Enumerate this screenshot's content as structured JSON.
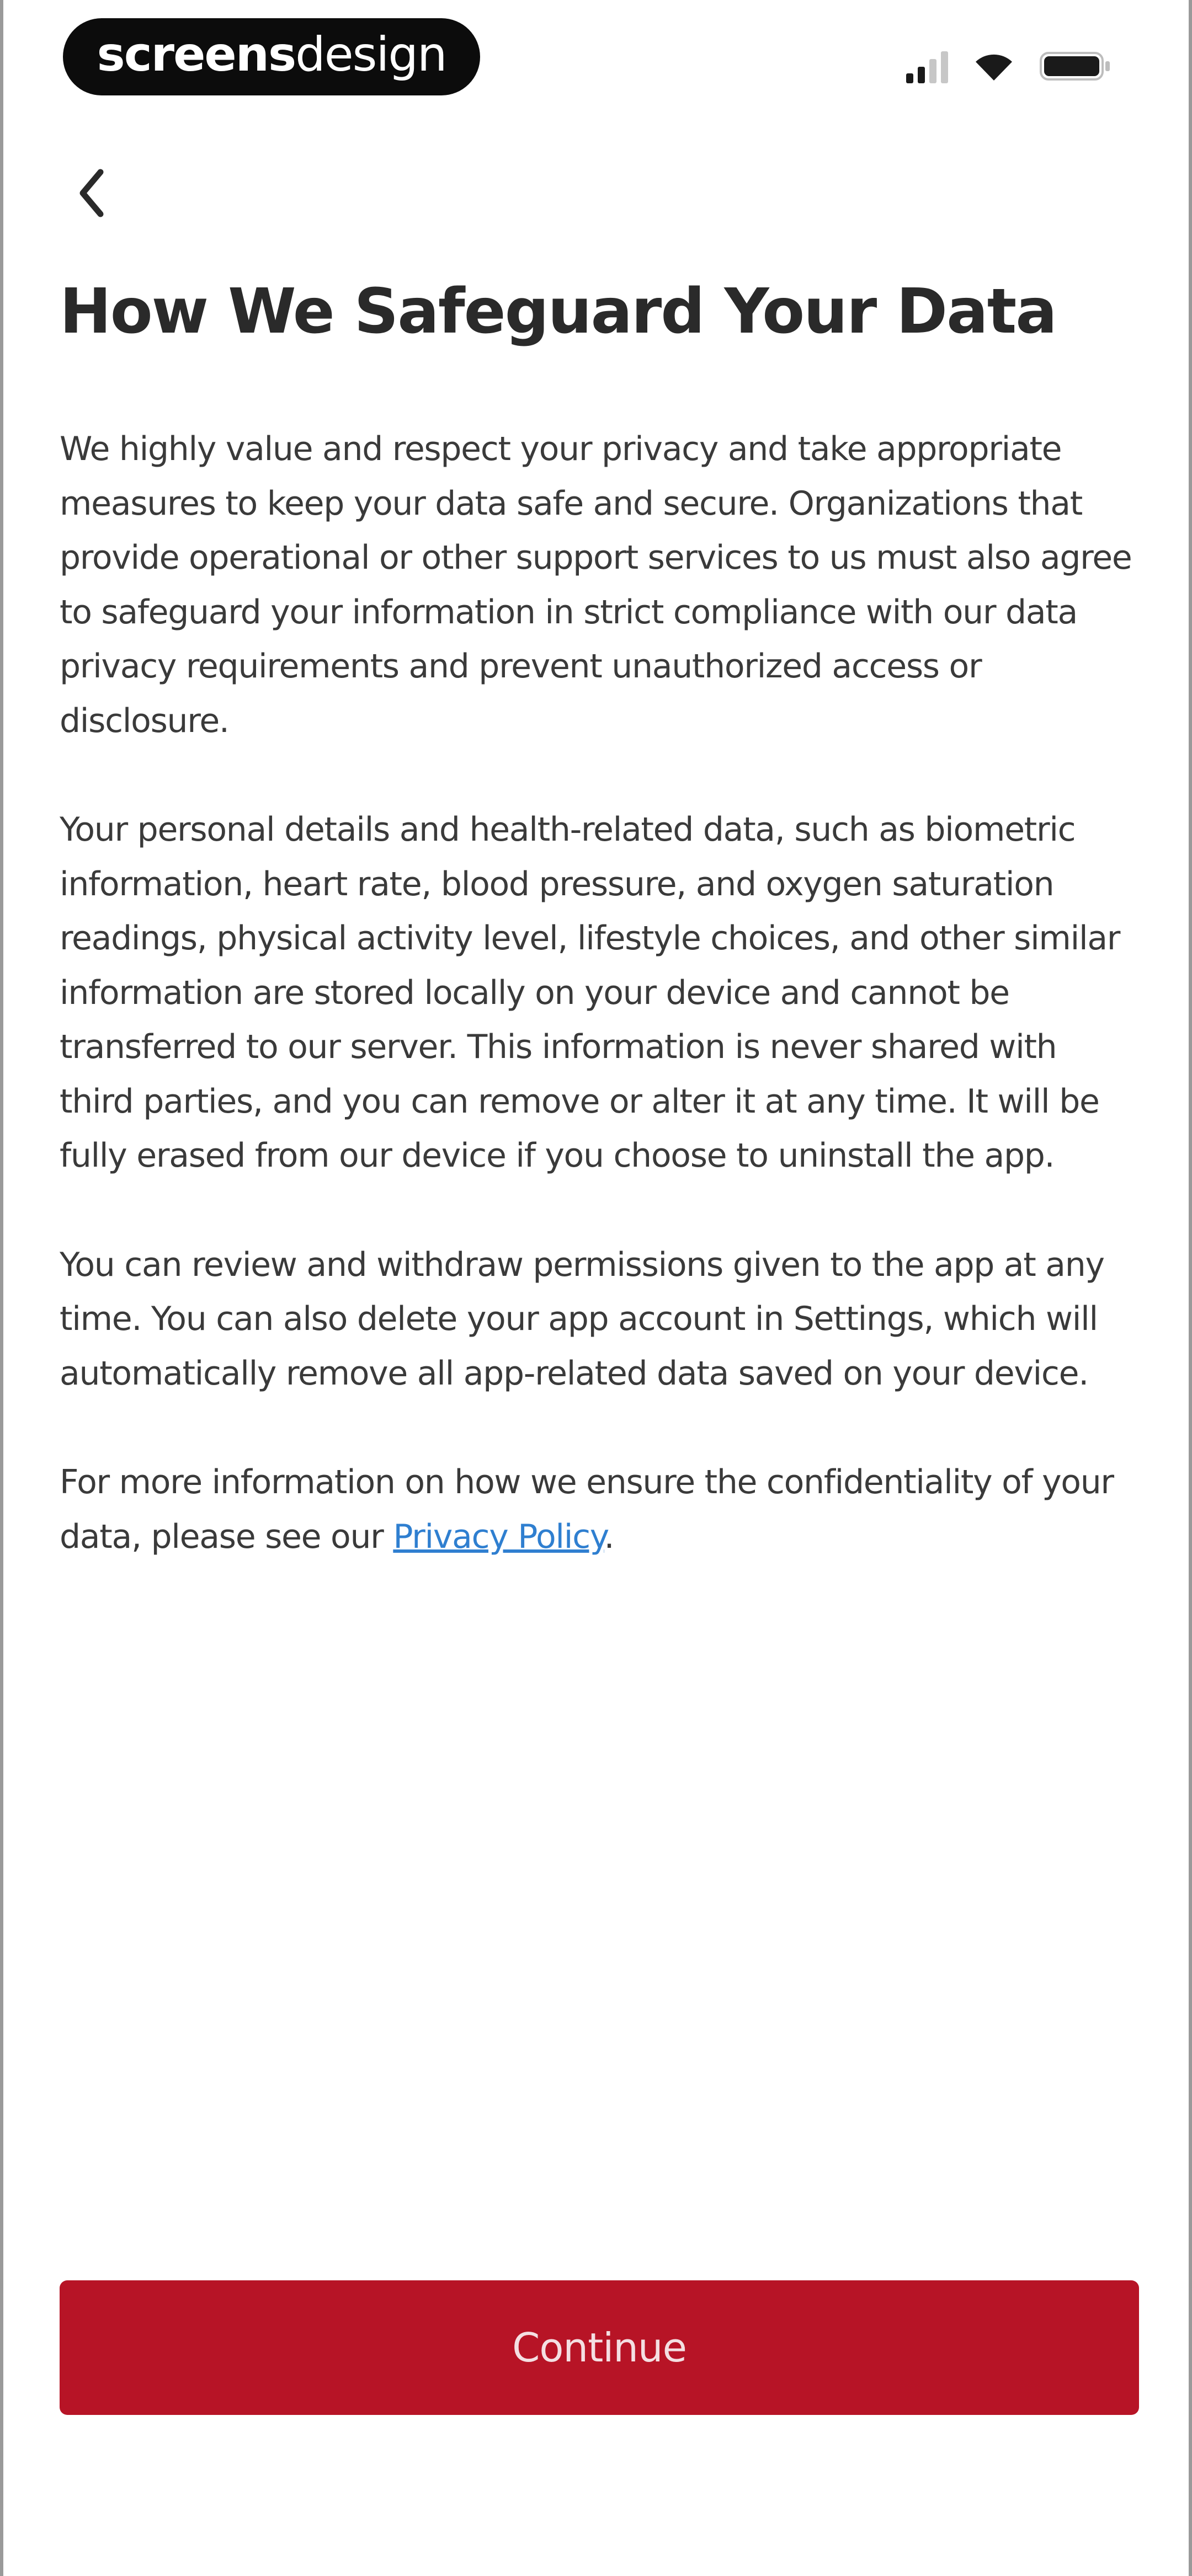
{
  "status_bar": {
    "brand_bold": "screens",
    "brand_light": "design",
    "icons": [
      "signal-icon",
      "wifi-icon",
      "battery-icon"
    ]
  },
  "nav": {
    "back_icon": "chevron-left-icon"
  },
  "page": {
    "title": "How We Safeguard Your Data",
    "paragraphs": [
      "We highly value and respect your privacy and take appropriate measures to keep your data safe and secure. Organizations that provide operational or other support services to us must also agree to safeguard your information in strict compliance with our data privacy requirements and prevent unauthorized access or disclosure.",
      "Your personal details and health-related data, such as biometric information, heart rate, blood pressure, and oxygen saturation readings, physical activity level, lifestyle choices, and other similar information are stored locally on your device and cannot be transferred to our server. This information is never shared with third parties, and you can remove or alter it at any time. It will be fully erased from our device if you choose to uninstall the app.",
      "You can review and withdraw permissions given to the app at any time. You can also delete your app account in Settings, which will automatically remove all app-related data saved on your device."
    ],
    "closing_text": "For more information on how we ensure the confidentiality of your data, please see our ",
    "privacy_link": "Privacy Policy",
    "closing_end": "."
  },
  "footer": {
    "continue_label": "Continue"
  },
  "colors": {
    "accent": "#b71426",
    "link": "#2f7fd0",
    "title": "#2a2a2a",
    "body_text": "#3a3a3a"
  }
}
